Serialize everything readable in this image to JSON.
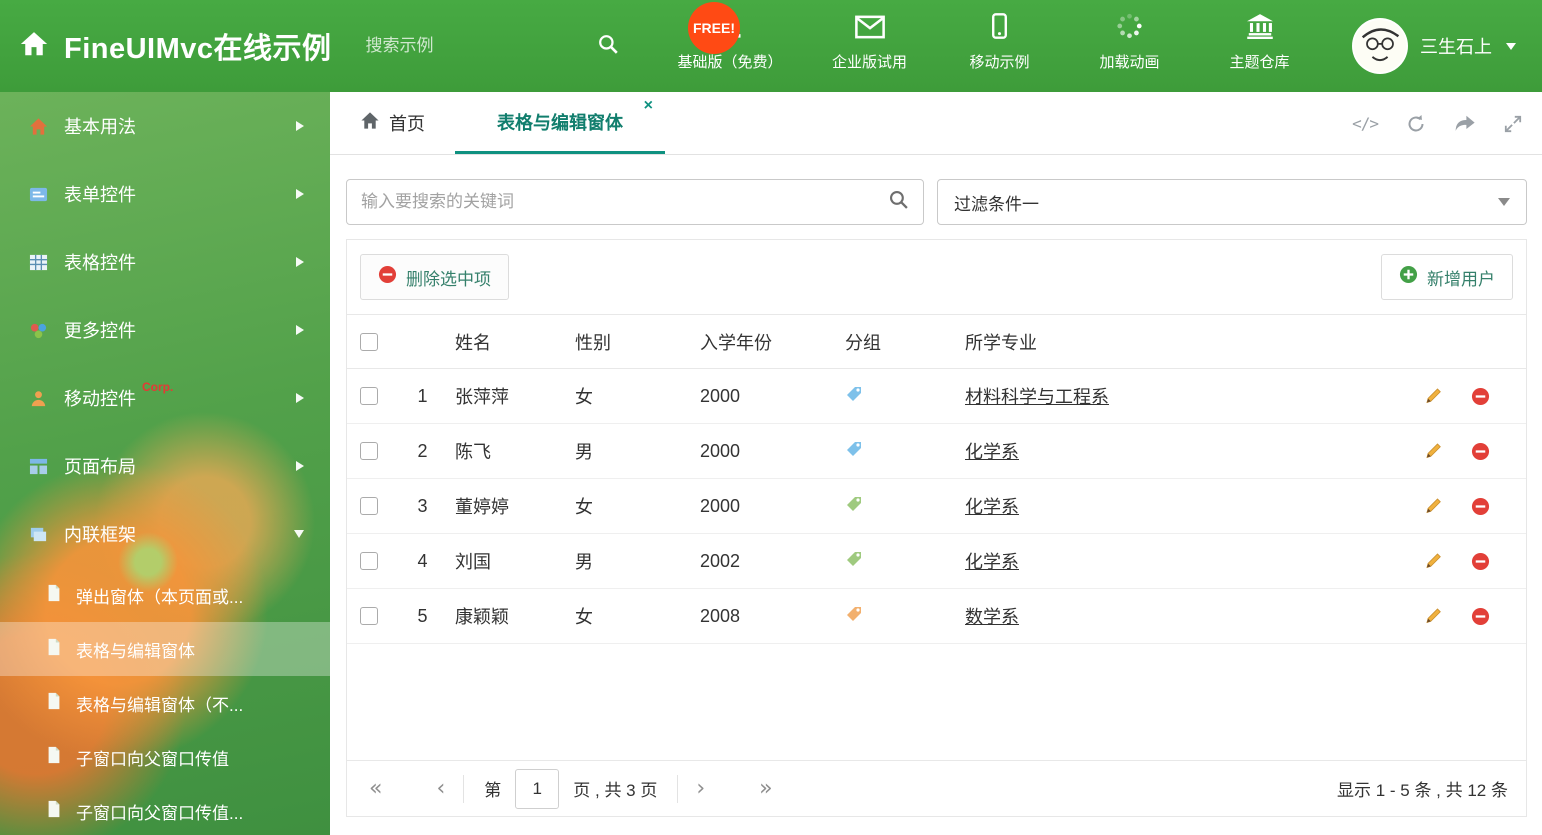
{
  "header": {
    "title": "FineUIMvc在线示例",
    "search_placeholder": "搜索示例",
    "free_badge": "FREE!",
    "nav_items": [
      {
        "label": "基础版（免费）",
        "icon": "download-icon"
      },
      {
        "label": "企业版试用",
        "icon": "mail-icon"
      },
      {
        "label": "移动示例",
        "icon": "mobile-icon"
      },
      {
        "label": "加载动画",
        "icon": "spinner-icon"
      },
      {
        "label": "主题仓库",
        "icon": "bank-icon"
      }
    ],
    "user": {
      "name": "三生石上"
    }
  },
  "sidebar": {
    "items": [
      {
        "label": "基本用法",
        "icon": "home-icon"
      },
      {
        "label": "表单控件",
        "icon": "form-icon"
      },
      {
        "label": "表格控件",
        "icon": "grid-icon"
      },
      {
        "label": "更多控件",
        "icon": "more-icon"
      },
      {
        "label": "移动控件",
        "badge": "Corp.",
        "icon": "person-icon"
      },
      {
        "label": "页面布局",
        "icon": "layout-icon"
      },
      {
        "label": "内联框架",
        "icon": "frame-icon",
        "expanded": true
      }
    ],
    "children": [
      {
        "label": "弹出窗体（本页面或..."
      },
      {
        "label": "表格与编辑窗体",
        "selected": true
      },
      {
        "label": "表格与编辑窗体（不..."
      },
      {
        "label": "子窗口向父窗口传值"
      },
      {
        "label": "子窗口向父窗口传值..."
      }
    ]
  },
  "tabs": {
    "home": "首页",
    "active": "表格与编辑窗体",
    "close_glyph": "×",
    "code_glyph": "</>"
  },
  "filter": {
    "search_placeholder": "输入要搜索的关键词",
    "dropdown_value": "过滤条件一"
  },
  "toolbar": {
    "delete_label": "删除选中项",
    "add_label": "新增用户"
  },
  "table": {
    "columns": {
      "name": "姓名",
      "gender": "性别",
      "year": "入学年份",
      "group": "分组",
      "major": "所学专业"
    },
    "rows": [
      {
        "num": "1",
        "name": "张萍萍",
        "gender": "女",
        "year": "2000",
        "tag_color": "#7ec1ea",
        "major": "材料科学与工程系"
      },
      {
        "num": "2",
        "name": "陈飞",
        "gender": "男",
        "year": "2000",
        "tag_color": "#7ec1ea",
        "major": "化学系"
      },
      {
        "num": "3",
        "name": "董婷婷",
        "gender": "女",
        "year": "2000",
        "tag_color": "#9fca7f",
        "major": "化学系"
      },
      {
        "num": "4",
        "name": "刘国",
        "gender": "男",
        "year": "2002",
        "tag_color": "#9fca7f",
        "major": "化学系"
      },
      {
        "num": "5",
        "name": "康颖颖",
        "gender": "女",
        "year": "2008",
        "tag_color": "#f2b06e",
        "major": "数学系"
      }
    ]
  },
  "pagination": {
    "first": "«",
    "prev": "‹",
    "page_prefix": "第",
    "current_page": "1",
    "page_suffix": "页 , 共 3 页",
    "next": "›",
    "last": "»",
    "summary": "显示 1 - 5 条 , 共 12 条"
  },
  "colors": {
    "header_green": "#42a53f",
    "accent_teal": "#0f9180",
    "delete_red": "#e23f38",
    "add_green": "#43a047",
    "pencil_orange": "#f0b13e",
    "free_badge": "#ff4a14"
  }
}
